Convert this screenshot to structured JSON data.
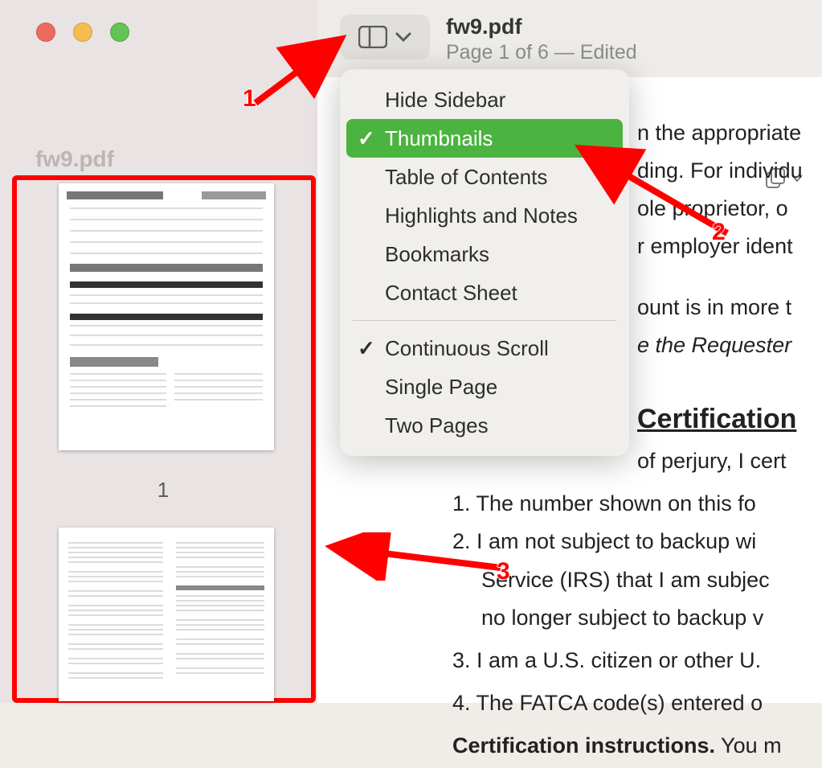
{
  "sidebar": {
    "title": "fw9.pdf",
    "page_number_1": "1"
  },
  "toolbar": {
    "file_title": "fw9.pdf",
    "page_status": "Page 1 of 6  —  Edited"
  },
  "menu": {
    "items": [
      {
        "label": "Hide Sidebar",
        "checked": false
      },
      {
        "label": "Thumbnails",
        "checked": true
      },
      {
        "label": "Table of Contents",
        "checked": false
      },
      {
        "label": "Highlights and Notes",
        "checked": false
      },
      {
        "label": "Bookmarks",
        "checked": false
      },
      {
        "label": "Contact Sheet",
        "checked": false
      }
    ],
    "items2": [
      {
        "label": "Continuous Scroll",
        "checked": true
      },
      {
        "label": "Single Page",
        "checked": false
      },
      {
        "label": "Two Pages",
        "checked": false
      }
    ]
  },
  "doc": {
    "lines": {
      "l1": "n the appropriate",
      "l2": "ding. For individu",
      "l3": "ole proprietor, o",
      "l4": "r employer ident",
      "l5": "ount is in more t",
      "l6": "e the Requester",
      "heading": "Certification",
      "pj": " of perjury, I cert",
      "n1": "1. The number shown on this fo",
      "n2a": "2. I am not subject to backup wi",
      "n2b": "Service (IRS) that I am subjec",
      "n2c": "no longer subject to backup v",
      "n3": "3. I am a U.S. citizen or other U.",
      "n4": "4. The FATCA code(s) entered o",
      "ci": "Certification instructions.",
      "ci_tail": " You m"
    }
  },
  "annotations": {
    "a1": "1",
    "a2": "2",
    "a3": "3"
  }
}
